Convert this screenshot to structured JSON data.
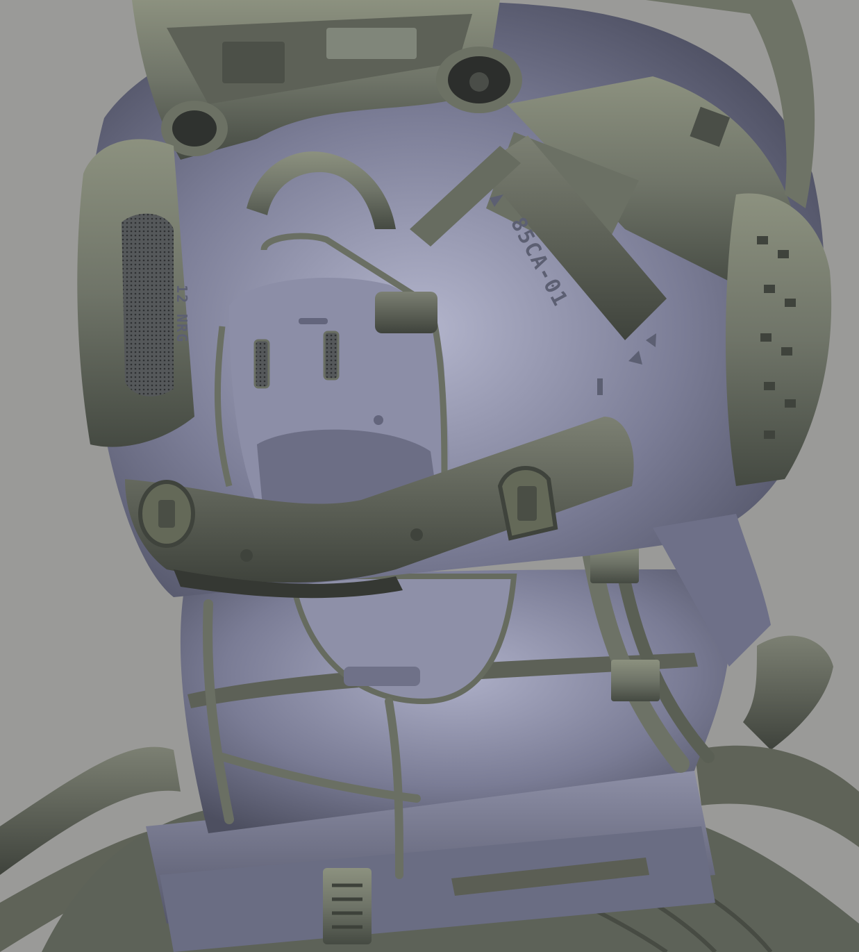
{
  "scene": {
    "background": "#9a9a98",
    "armor_color": "#7b7d96",
    "armor_highlight": "#b3b5cc",
    "armor_shadow": "#4a4c5e",
    "detail_color": "#6f7468",
    "detail_shadow": "#454a42"
  },
  "decals": {
    "cheek_code": "85CA-01",
    "side_code": "12 NRG"
  }
}
